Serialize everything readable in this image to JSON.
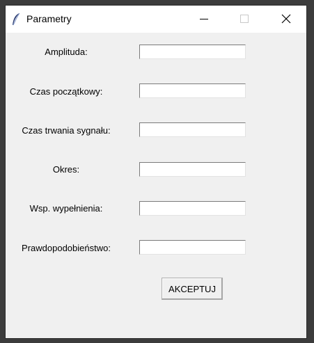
{
  "window": {
    "title": "Parametry",
    "icon": "feather-icon",
    "controls": [
      "minimize-icon",
      "maximize-icon",
      "close-icon"
    ]
  },
  "form": {
    "fields": [
      {
        "label": "Amplituda:",
        "value": ""
      },
      {
        "label": "Czas początkowy:",
        "value": ""
      },
      {
        "label": "Czas trwania sygnału:",
        "value": ""
      },
      {
        "label": "Okres:",
        "value": ""
      },
      {
        "label": "Wsp. wypełnienia:",
        "value": ""
      },
      {
        "label": "Prawdopodobieństwo:",
        "value": ""
      }
    ],
    "submit_label": "AKCEPTUJ"
  }
}
